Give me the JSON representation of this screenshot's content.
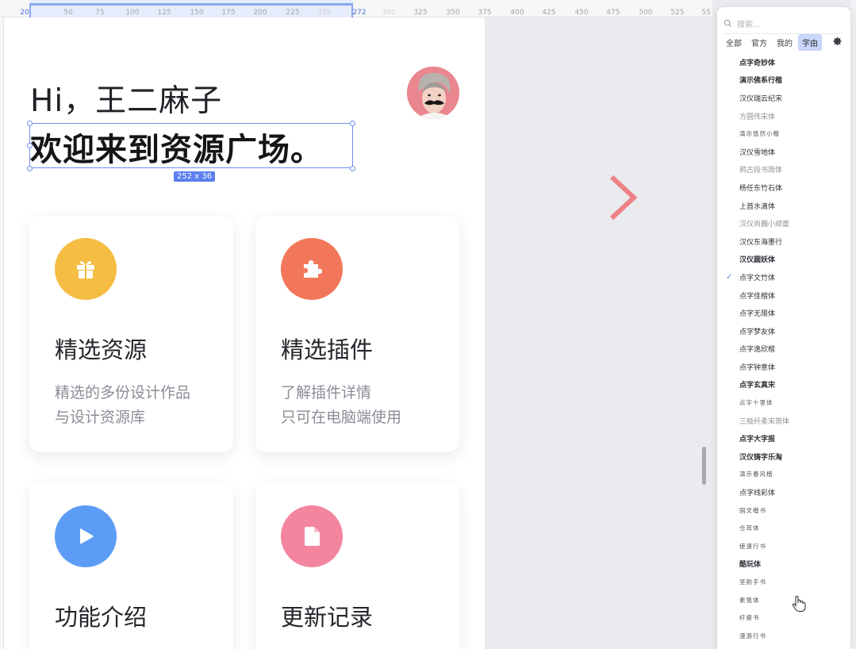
{
  "ruler": {
    "ticks": [
      "20",
      "50",
      "75",
      "100",
      "125",
      "150",
      "175",
      "200",
      "225",
      "250",
      "272",
      "300",
      "325",
      "350",
      "375",
      "400",
      "425",
      "450",
      "475",
      "500",
      "525",
      "55"
    ]
  },
  "artboard": {
    "greeting": "Hi，王二麻子",
    "welcome": "欢迎来到资源广场。",
    "selection_size": "252 x 36"
  },
  "cards": [
    {
      "title": "精选资源",
      "desc1": "精选的多份设计作品",
      "desc2": "与设计资源库",
      "icon": "gift-icon",
      "color": "#f5bd43"
    },
    {
      "title": "精选插件",
      "desc1": "了解插件详情",
      "desc2": "只可在电脑端使用",
      "icon": "puzzle-icon",
      "color": "#f2775a"
    },
    {
      "title": "功能介绍",
      "icon": "play-icon",
      "color": "#5c9cf7"
    },
    {
      "title": "更新记录",
      "icon": "file-icon",
      "color": "#f385a1"
    }
  ],
  "font_panel": {
    "search_placeholder": "搜索...",
    "tabs": [
      "全部",
      "官方",
      "我的",
      "字由"
    ],
    "active_tab": "字由",
    "fonts": [
      "点字奇妙体",
      "演示佛系行楷",
      "汉仪瑞云纪宋",
      "方圆伟宋体",
      "演示悠然小楷",
      "汉仪雪地体",
      "鸦古段书简体",
      "杨任东竹石体",
      "上首水滴体",
      "汉仪尚巍小顽童",
      "汉仪东海墨行",
      "汉仪圆妖体",
      "点字文竹体",
      "点字佳楷体",
      "点字无限体",
      "点字梦友体",
      "点字逸欣楷",
      "点字钟意体",
      "点字玄真宋",
      "点字十里体",
      "三极纤柔宋简体",
      "点字大字报",
      "汉仪铸字乐淘",
      "演示春风楷",
      "点字线彩体",
      "国文楷书",
      "仓耳体",
      "使速行书",
      "酷玩体",
      "坚韵手书",
      "素笺体",
      "纤瘦书",
      "漫游行书"
    ],
    "checked_font": "点字文竹体"
  },
  "colors": {
    "accent": "#5b7ef0",
    "chevron": "#ee8187"
  }
}
